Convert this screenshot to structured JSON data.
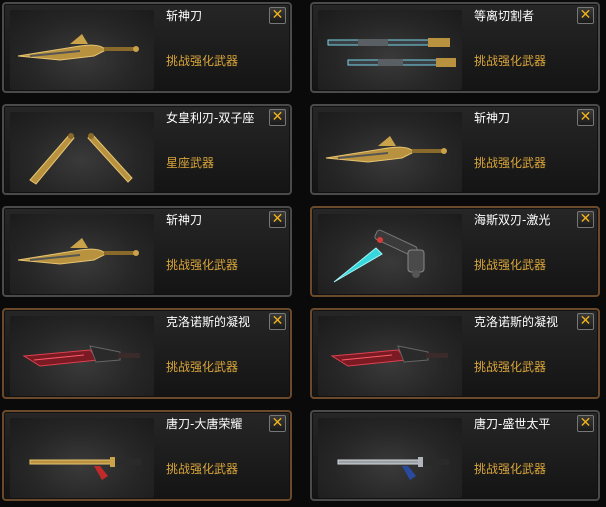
{
  "colors": {
    "name_text": "#ffffff",
    "category_text": "#d9a53a",
    "close_x": "#f2b318"
  },
  "close_label": "✕",
  "cards": [
    {
      "name": "斩神刀",
      "category": "挑战强化武器",
      "icon": "golden-blade-icon"
    },
    {
      "name": "等离切割者",
      "category": "挑战强化武器",
      "icon": "plasma-cutter-icon"
    },
    {
      "name": "女皇利刃-双子座",
      "category": "星座武器",
      "icon": "twin-daggers-icon"
    },
    {
      "name": "斩神刀",
      "category": "挑战强化武器",
      "icon": "golden-blade-icon"
    },
    {
      "name": "斩神刀",
      "category": "挑战强化武器",
      "icon": "golden-blade-icon"
    },
    {
      "name": "海斯双刃-激光",
      "category": "挑战强化武器",
      "icon": "laser-blade-icon"
    },
    {
      "name": "克洛诺斯的凝视",
      "category": "挑战强化武器",
      "icon": "red-blade-icon"
    },
    {
      "name": "克洛诺斯的凝视",
      "category": "挑战强化武器",
      "icon": "red-blade-icon"
    },
    {
      "name": "唐刀-大唐荣耀",
      "category": "挑战强化武器",
      "icon": "tang-sword-gold-icon"
    },
    {
      "name": "唐刀-盛世太平",
      "category": "挑战强化武器",
      "icon": "tang-sword-silver-icon"
    }
  ]
}
